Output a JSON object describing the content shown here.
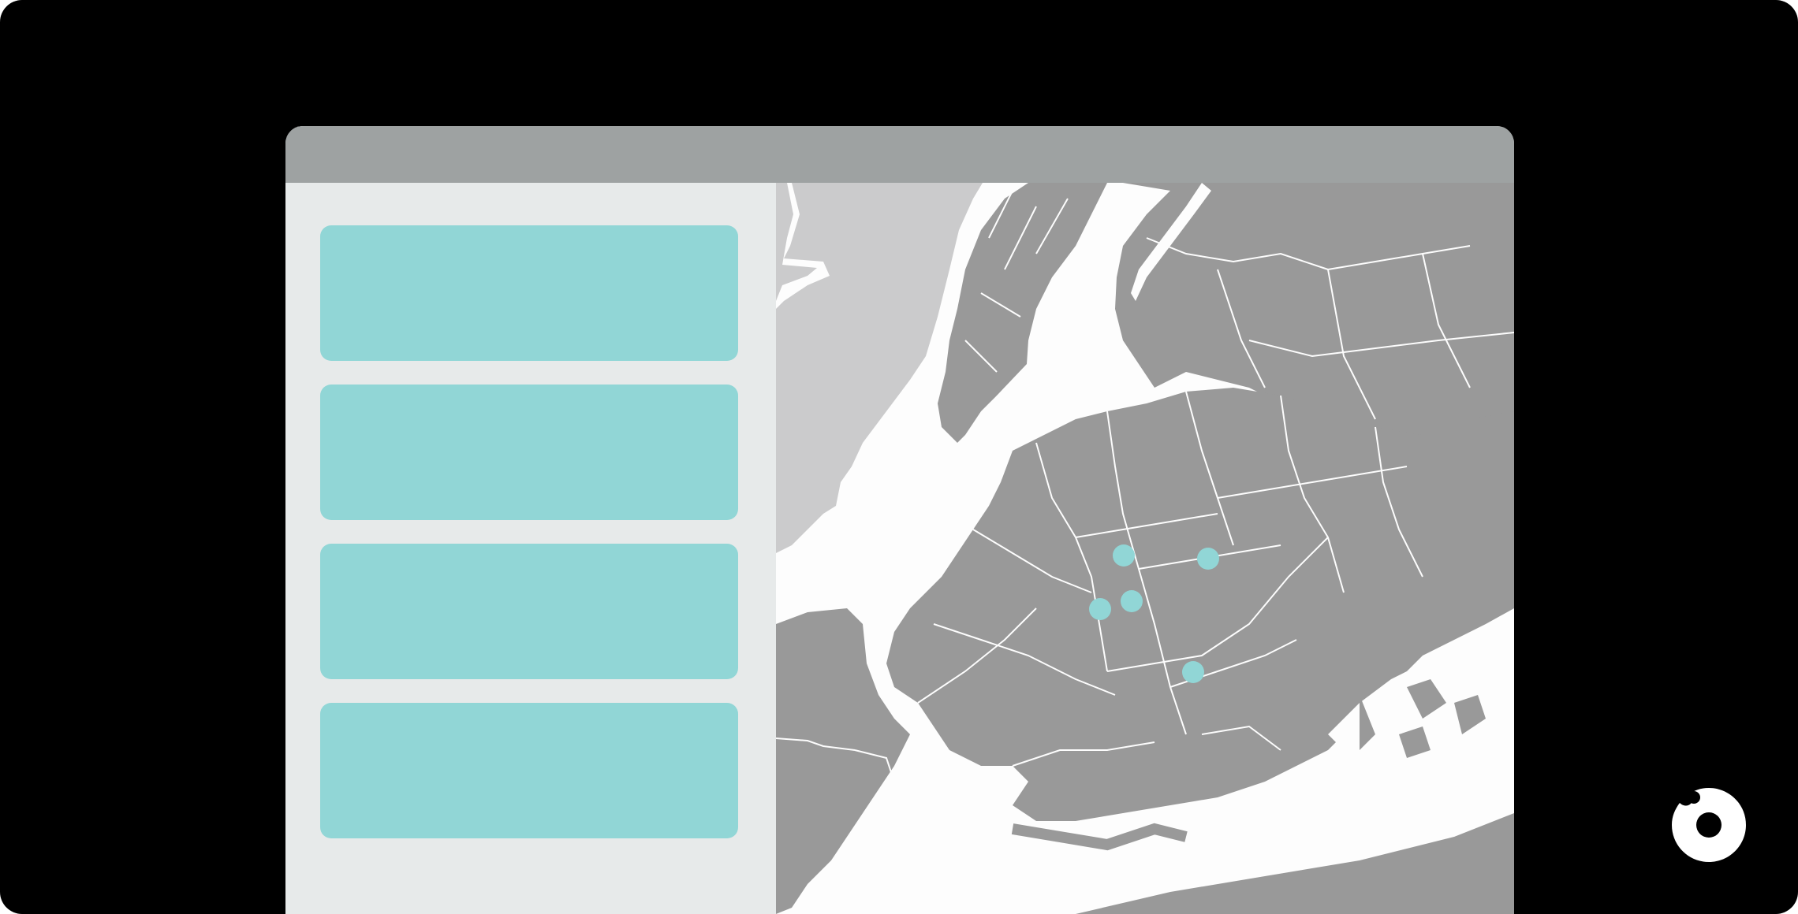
{
  "window": {
    "titlebar_color": "#9ea2a2",
    "sidebar_color": "#e7eaea"
  },
  "sidebar": {
    "cards": [
      {
        "name": "result-card-1",
        "color": "#91d6d6"
      },
      {
        "name": "result-card-2",
        "color": "#91d6d6"
      },
      {
        "name": "result-card-3",
        "color": "#91d6d6"
      },
      {
        "name": "result-card-4",
        "color": "#91d6d6"
      }
    ]
  },
  "map": {
    "land_color": "#999999",
    "water_color": "#fdfdfd",
    "mainland_color": "#cbcbcc",
    "marker_color": "#91d6d6",
    "markers": 5
  },
  "brand": {
    "icon": "brand-logo-icon"
  }
}
